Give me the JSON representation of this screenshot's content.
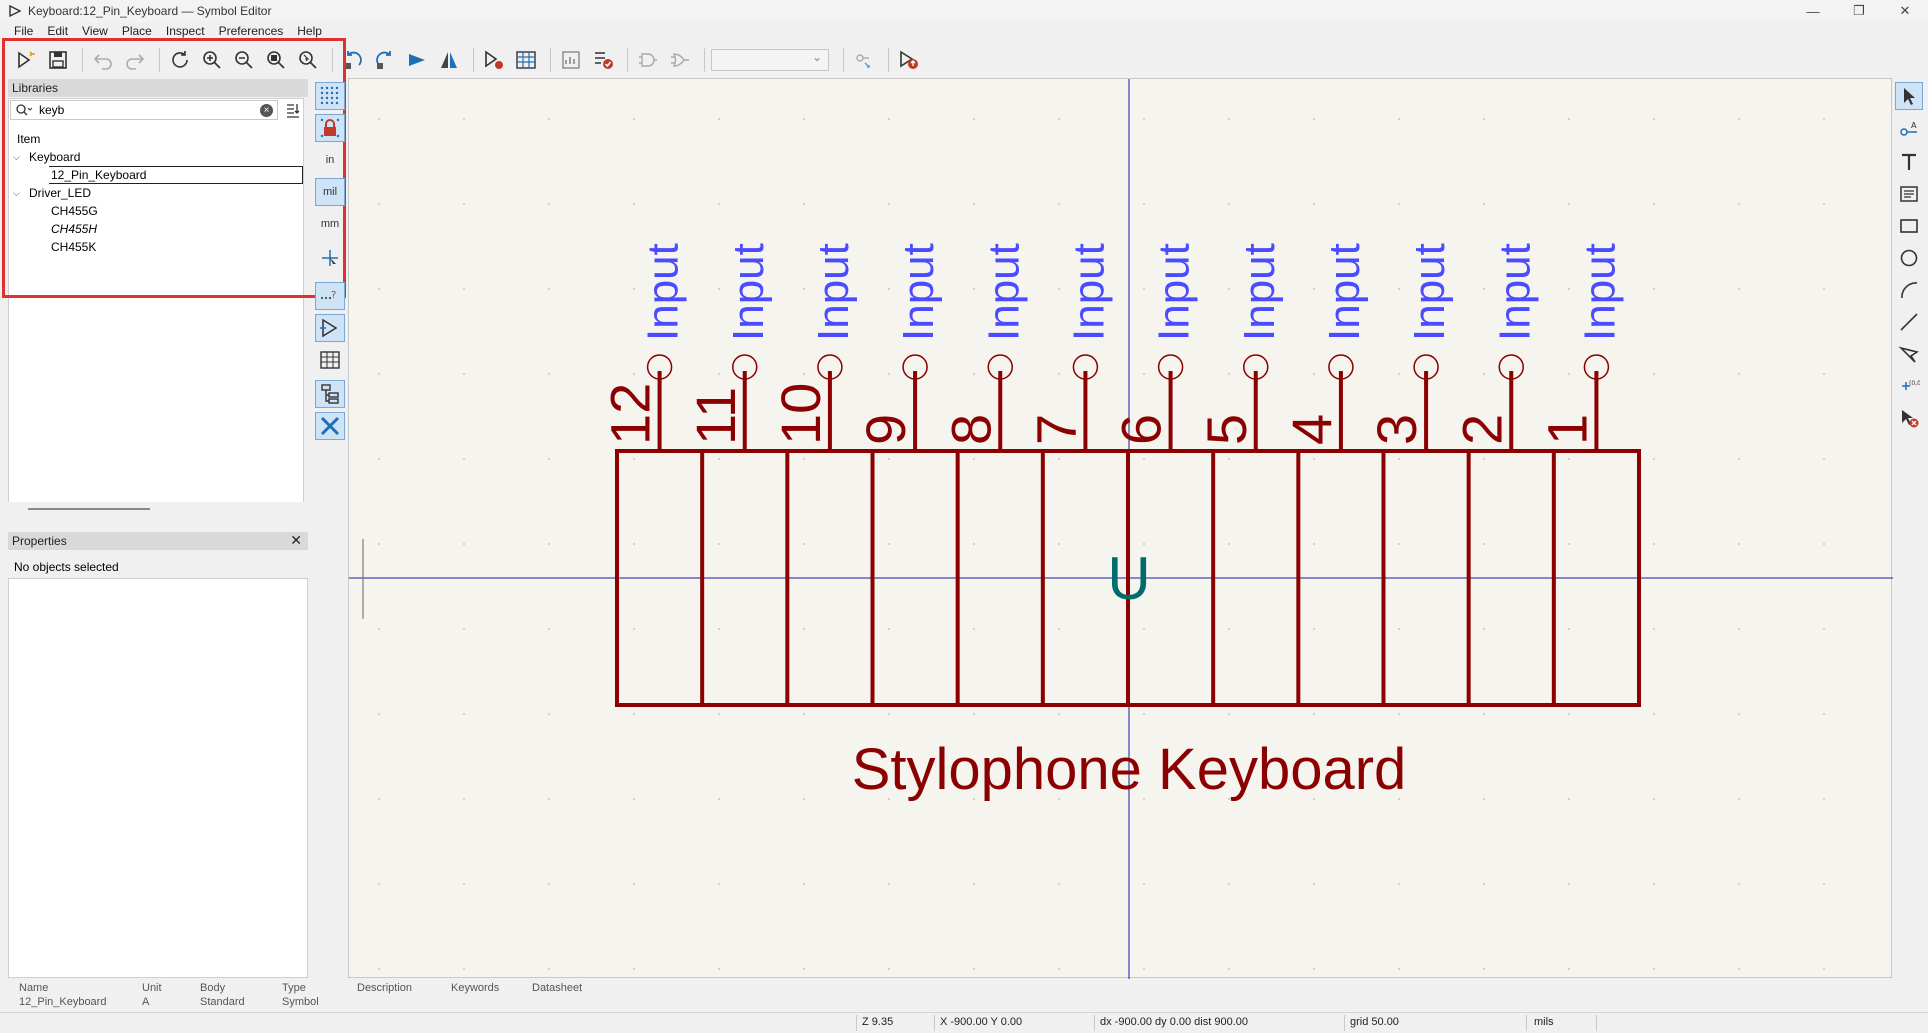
{
  "window": {
    "title": "Keyboard:12_Pin_Keyboard — Symbol Editor",
    "controls": [
      "—",
      "❐",
      "✕"
    ]
  },
  "menu": [
    "File",
    "Edit",
    "View",
    "Place",
    "Inspect",
    "Preferences",
    "Help"
  ],
  "toolbar_icons": [
    "new-symbol-icon",
    "save-icon",
    "undo-icon",
    "redo-icon",
    "refresh-icon",
    "zoom-in-icon",
    "zoom-out-icon",
    "zoom-fit-icon",
    "zoom-object-icon",
    "rotate-ccw-icon",
    "rotate-cw-icon",
    "mirror-horizontal-icon",
    "mirror-vertical-icon",
    "symbol-properties-icon",
    "pin-table-icon",
    "simulation-icon",
    "check-icon",
    "deMorgan-standard-icon",
    "deMorgan-alternate-icon",
    "unit-select",
    "pin-sync-icon",
    "load-symbol-icon"
  ],
  "libraries": {
    "header": "Libraries",
    "search_value": "keyb",
    "tree_header": "Item",
    "groups": [
      {
        "name": "Keyboard",
        "items": [
          "12_Pin_Keyboard"
        ]
      },
      {
        "name": "Driver_LED",
        "items": [
          "CH455G",
          "CH455H",
          "CH455K"
        ]
      }
    ]
  },
  "properties": {
    "header": "Properties",
    "empty": "No objects selected"
  },
  "left_toolbar": {
    "in_label": "in",
    "mil_label": "mil",
    "mm_label": "mm"
  },
  "symbol": {
    "pin_type": "Input",
    "pin_numbers": [
      "12",
      "11",
      "10",
      "9",
      "8",
      "7",
      "6",
      "5",
      "4",
      "3",
      "2",
      "1"
    ],
    "reference": "U",
    "value": "Stylophone Keyboard",
    "body_color": "#8b0000",
    "pin_type_color": "#4b4bff",
    "reference_color": "#006d6d"
  },
  "info_bar": {
    "headers": [
      "Name",
      "Unit",
      "Body",
      "Type",
      "Description",
      "Keywords",
      "Datasheet"
    ],
    "values": [
      "12_Pin_Keyboard",
      "A",
      "Standard",
      "Symbol",
      "",
      "",
      ""
    ]
  },
  "status_bar": {
    "zoom": "Z 9.35",
    "xy": "X -900.00  Y 0.00",
    "delta": "dx -900.00  dy 0.00  dist 900.00",
    "grid": "grid 50.00",
    "units": "mils"
  }
}
